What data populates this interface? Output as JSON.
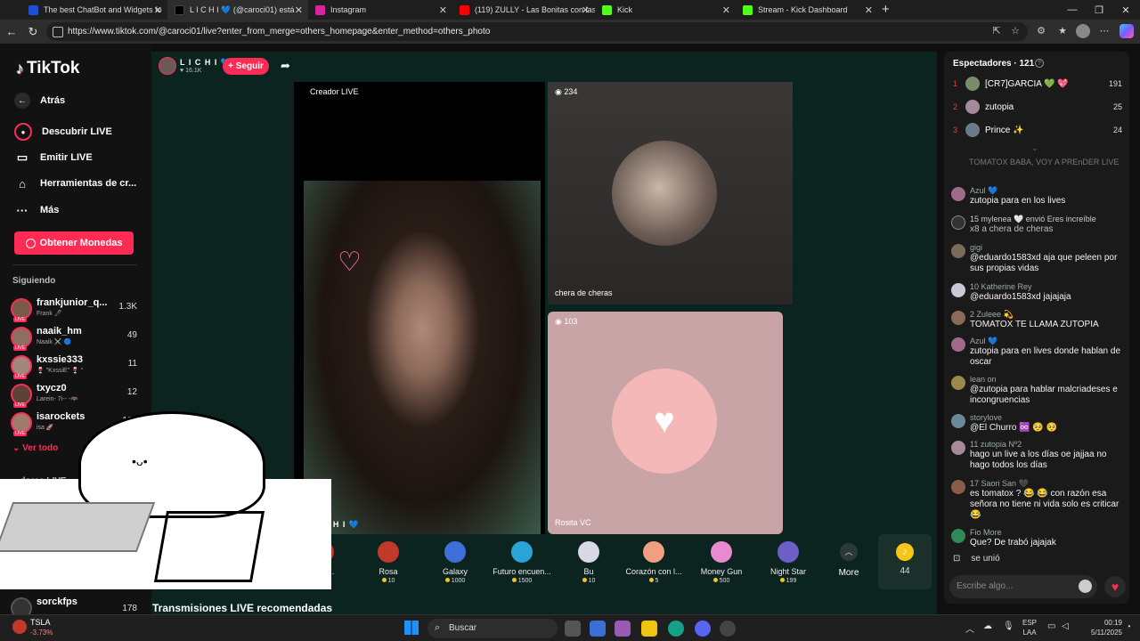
{
  "browser": {
    "tabs": [
      {
        "title": "The best ChatBot and Widgets fo",
        "color": "#1d4ed8"
      },
      {
        "title": "L I C H I 💙 (@caroci01) está",
        "color": "#000000"
      },
      {
        "title": "Instagram",
        "color": "#d6249f"
      },
      {
        "title": "(119) ZULLY - Las Bonitas con las",
        "color": "#ff0000"
      },
      {
        "title": "Kick",
        "color": "#53fc18"
      },
      {
        "title": "Stream - Kick Dashboard",
        "color": "#53fc18"
      }
    ],
    "url": "https://www.tiktok.com/@caroci01/live?enter_from_merge=others_homepage&enter_method=others_photo"
  },
  "sidebar": {
    "logo": "TikTok",
    "back": "Atrás",
    "nav": [
      "Descubrir LIVE",
      "Emitir LIVE",
      "Herramientas de cr...",
      "Más"
    ],
    "coins_button": "Obtener Monedas",
    "following_title": "Siguiendo",
    "following": [
      {
        "name": "frankjunior_q...",
        "sub": "Frank 🖊",
        "count": "1.3K",
        "color": "#7a5a48"
      },
      {
        "name": "naaik_hm",
        "sub": "Naaik ⚔️ 🔵",
        "count": "49",
        "color": "#8d6e63"
      },
      {
        "name": "kxssie333",
        "sub": "🍷 \"KxssiE\" 🍷 °",
        "count": "11",
        "color": "#a1887f"
      },
      {
        "name": "txycz0",
        "sub": "Larein- 7i-- -🦇",
        "count": "12",
        "color": "#5d4037"
      },
      {
        "name": "isarockets",
        "sub": "isa 🚀",
        "count": "105",
        "color": "#9e7b6b"
      }
    ],
    "see_all": "Ver todo",
    "section2_partial": "...dores LIVE",
    "bottom_user": {
      "name": "sorckfps",
      "count": "178"
    }
  },
  "stream": {
    "host_name": "L I C H I 💙",
    "host_likes": "♥ 16.1K",
    "follow_button": "+ Seguir",
    "creator_label": "Creador LIVE",
    "host_tag": "L I C H I 💙",
    "guest1": {
      "viewers": "234",
      "name": "chera de cheras"
    },
    "guest2": {
      "viewers": "103",
      "name": "Rosita VC"
    },
    "recommended": "Transmisiones LIVE recomendadas"
  },
  "gifts": {
    "items": [
      {
        "name": "...n l...",
        "price": "",
        "color": "#c0392b"
      },
      {
        "name": "Rosa",
        "price": "10",
        "color": "#c0392b"
      },
      {
        "name": "Galaxy",
        "price": "1000",
        "color": "#3f6fd8"
      },
      {
        "name": "Futuro encuen...",
        "price": "1500",
        "color": "#2aa3d8"
      },
      {
        "name": "Bu",
        "price": "10",
        "color": "#d8d8e6"
      },
      {
        "name": "Corazón con l...",
        "price": "5",
        "color": "#f0a080"
      },
      {
        "name": "Money Gun",
        "price": "500",
        "color": "#e88ad0"
      },
      {
        "name": "Night Star",
        "price": "199",
        "color": "#6c5fc7"
      }
    ],
    "more": "More",
    "coins": "44"
  },
  "panel": {
    "viewers_label": "Espectadores · 121",
    "top_viewers": [
      {
        "rank": "1",
        "name": "[CR7]GARCIA 💚 💖",
        "count": "191",
        "color": "#7a8a6a"
      },
      {
        "rank": "2",
        "name": "zutopia",
        "count": "25",
        "color": "#a58a9a"
      },
      {
        "rank": "3",
        "name": "Prince ✨",
        "count": "24",
        "color": "#6a7a8a"
      }
    ],
    "faded": "TOMATOX BABA, VOY A PREnDER LIVE",
    "comments": [
      {
        "name": "Azul 💙",
        "text": "zutopia para en los lives",
        "color": "#a06a8a"
      },
      {
        "name": "15 mylenea 🤍 envió Eres increíble",
        "text": "x8 a chera de cheras",
        "color": "#333333"
      },
      {
        "name": "gigi",
        "text": "@eduardo1583xd aja que peleen por sus propias vidas",
        "color": "#7a6a5a"
      },
      {
        "name": "10 Katherine Rey",
        "text": "@eduardo1583xd jajajaja",
        "color": "#c8c8d8"
      },
      {
        "name": "2 Zuleee 💫",
        "text": "TOMATOX TE LLAMA ZUTOPIA",
        "color": "#8a6a5a"
      },
      {
        "name": "Azul 💙",
        "text": "zutopia para en lives donde hablan de oscar",
        "color": "#a06a8a"
      },
      {
        "name": "lean on",
        "text": "@zutopia para hablar malcriadeses e incongruencias",
        "color": "#9a8a4a"
      },
      {
        "name": "storylove",
        "text": "@El Churro ♾️ 🥺 🥺",
        "color": "#6a8a9a"
      },
      {
        "name": "11 zutopia Nº2",
        "text": "hago un live a los días oe jajjaa no hago todos los días",
        "color": "#a58a9a"
      },
      {
        "name": "17 Saori San 🖤",
        "text": "es tomatox ? 😂 😂 con razón esa señora no tiene ni vida solo es criticar 😂",
        "color": "#8a5a4a"
      },
      {
        "name": "Fio More",
        "text": "Que? De trabó jajajak",
        "color": "#2e8b57"
      }
    ],
    "joined": "se unió",
    "input_placeholder": "Escribe algo..."
  },
  "taskbar": {
    "stock_name": "TSLA",
    "stock_change": "-3.73%",
    "search": "Buscar",
    "lang": "ESP",
    "lang2": "LAA",
    "time": "00:19",
    "date": "5/11/2025"
  }
}
